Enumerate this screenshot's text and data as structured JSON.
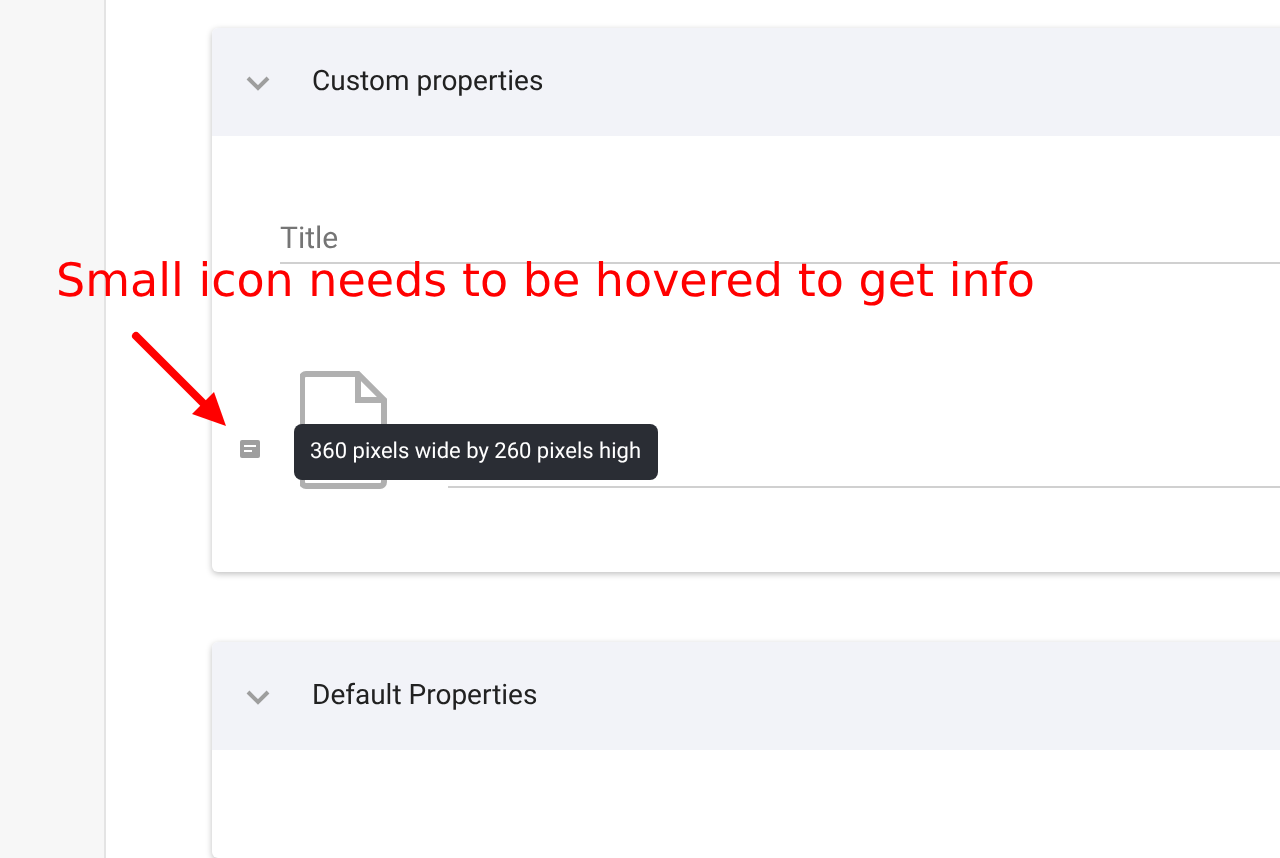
{
  "panels": [
    {
      "title": "Custom properties",
      "field_label": "Title",
      "tooltip": "360 pixels wide by 260 pixels high"
    },
    {
      "title": "Default Properties"
    }
  ],
  "annotation": {
    "text": "Small icon needs to be hovered to get info"
  }
}
